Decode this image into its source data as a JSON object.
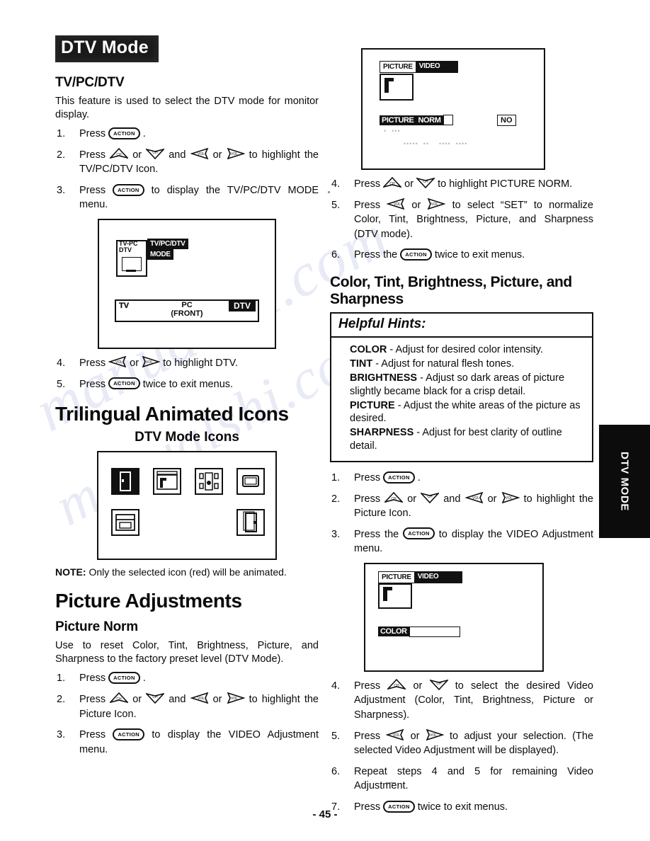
{
  "document": {
    "page_number": "- 45 -",
    "side_tab": "DTV MODE"
  },
  "watermark": {
    "text": "manualshi.com"
  },
  "left_column": {
    "banner": "DTV Mode",
    "section1": {
      "heading": "TV/PC/DTV",
      "intro": "This feature is used to select the DTV mode for monitor display.",
      "steps": [
        {
          "num": "1.",
          "before": "Press",
          "key": "ACTION",
          "after": "."
        },
        {
          "num": "2.",
          "before": "Press",
          "key": "arrows-ch-vol",
          "after": "to highlight the TV/PC/DTV Icon."
        },
        {
          "num": "3.",
          "before": "Press",
          "key": "ACTION",
          "after": "to display the TV/PC/DTV MODE menu."
        },
        {
          "num": "4.",
          "before": "Press",
          "key": "arrows-vol",
          "after": "to highlight DTV."
        },
        {
          "num": "5.",
          "before": "Press",
          "key": "ACTION",
          "after": "twice to exit menus."
        }
      ],
      "osd": {
        "icon_label_line1": "TV-PC",
        "icon_label_line2": "DTV",
        "title_line1": "TV/PC/DTV",
        "title_line2": "MODE",
        "bar_tv": "TV",
        "bar_pc": "PC",
        "bar_pc_sub": "(FRONT)",
        "bar_dtv": "DTV"
      }
    },
    "section2": {
      "heading": "Trilingual Animated Icons",
      "subheading": "DTV Mode Icons",
      "icons": [
        {
          "name": "icon-selected-vertical",
          "selected": true
        },
        {
          "name": "icon-picture-adjust",
          "selected": false
        },
        {
          "name": "icon-audio-speakers",
          "selected": false
        },
        {
          "name": "icon-screen-display",
          "selected": false
        },
        {
          "name": "icon-setup-panel",
          "selected": false
        },
        {
          "name": "icon-lock-vertical",
          "selected": false
        }
      ],
      "note_label": "NOTE:",
      "note_text": "Only the selected icon (red) will be animated."
    },
    "section3": {
      "heading": "Picture Adjustments",
      "subheading": "Picture Norm",
      "intro": "Use to reset Color, Tint, Brightness, Picture, and Sharpness to the factory preset level (DTV Mode).",
      "steps": [
        {
          "num": "1.",
          "before": "Press",
          "key": "ACTION",
          "after": "."
        },
        {
          "num": "2.",
          "before": "Press",
          "key": "arrows-ch-vol",
          "after": "to highlight the Picture Icon."
        },
        {
          "num": "3.",
          "before": "Press",
          "key": "ACTION",
          "after": "to display the VIDEO Adjustment menu."
        }
      ]
    }
  },
  "right_column": {
    "osd_top": {
      "tab_left": "PICTURE",
      "tab_right": "VIDEO",
      "row_label_a": "PICTURE",
      "row_label_b": "NORM",
      "row_value": "NO"
    },
    "steps_norm": [
      {
        "num": "4.",
        "before": "Press",
        "key": "arrows-ch",
        "after": "to highlight PICTURE NORM."
      },
      {
        "num": "5.",
        "before": "Press",
        "key": "arrows-vol",
        "after": "to select “SET” to normalize Color, Tint, Brightness, Picture, and Sharpness (DTV mode)."
      },
      {
        "num": "6.",
        "before": "Press the",
        "key": "ACTION",
        "after": "twice to exit menus."
      }
    ],
    "section_heading": "Color, Tint, Brightness, Picture, and Sharpness",
    "hints": {
      "title": "Helpful Hints:",
      "items": [
        {
          "term": "COLOR",
          "desc": "- Adjust for desired color intensity."
        },
        {
          "term": "TINT",
          "desc": "- Adjust for natural flesh tones."
        },
        {
          "term": "BRIGHTNESS",
          "desc": "- Adjust so dark areas of picture slightly became black for a crisp detail."
        },
        {
          "term": "PICTURE",
          "desc": "- Adjust the white areas of the picture as desired."
        },
        {
          "term": "SHARPNESS",
          "desc": "- Adjust for best clarity of outline detail."
        }
      ]
    },
    "steps_video_a": [
      {
        "num": "1.",
        "before": "Press",
        "key": "ACTION",
        "after": "."
      },
      {
        "num": "2.",
        "before": "Press",
        "key": "arrows-ch-vol",
        "after": "to highlight the Picture Icon."
      },
      {
        "num": "3.",
        "before": "Press the",
        "key": "ACTION",
        "after": "to display the VIDEO Adjustment menu."
      }
    ],
    "osd_bottom": {
      "tab_left": "PICTURE",
      "tab_right": "VIDEO",
      "row_label": "COLOR"
    },
    "steps_video_b": [
      {
        "num": "4.",
        "before": "Press",
        "key": "arrows-ch",
        "after": "to select the desired Video Adjustment (Color, Tint, Brightness, Picture or Sharpness)."
      },
      {
        "num": "5.",
        "before": "Press",
        "key": "arrows-vol",
        "after": "to adjust your selection. (The selected Video Adjustment will be displayed)."
      },
      {
        "num": "6.",
        "before": "Repeat steps 4 and 5 for remaining Video Adjustment.",
        "key": "",
        "after": ""
      },
      {
        "num": "7.",
        "before": "Press",
        "key": "ACTION",
        "after": "twice to exit menus."
      }
    ]
  },
  "keys": {
    "action_label": "ACTION",
    "ch_label": "CH",
    "vol_label": "VOL"
  },
  "colors": {
    "ink": "#0a0a0a",
    "paper": "#ffffff",
    "inverted_bg": "#111111",
    "watermark": "#7884c8"
  }
}
